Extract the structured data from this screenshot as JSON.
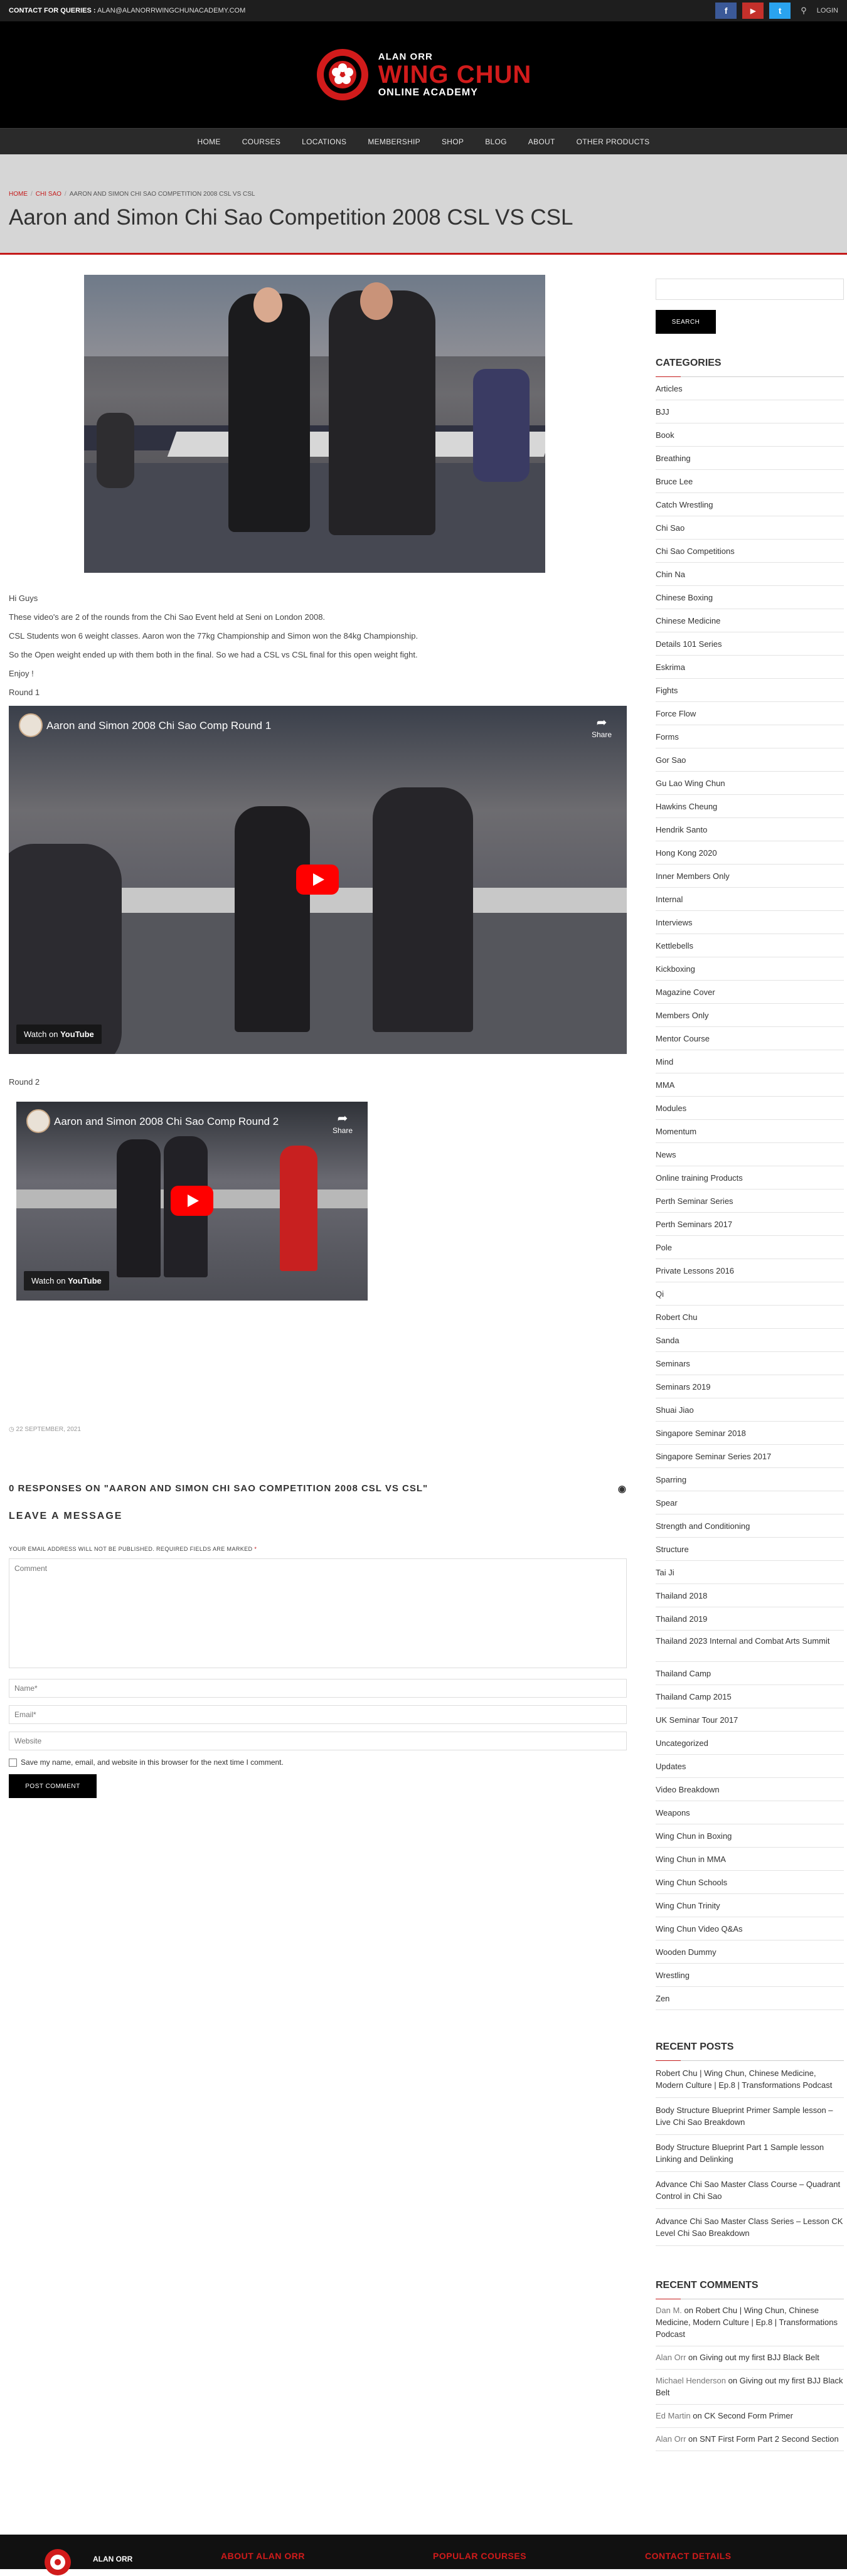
{
  "topbar": {
    "contact_label": "CONTACT FOR QUERIES :",
    "contact_email": "ALAN@ALANORRWINGCHUNACADEMY.COM",
    "social": [
      {
        "name": "facebook-icon",
        "glyph": "f",
        "color": "#3b5998"
      },
      {
        "name": "youtube-icon",
        "glyph": "▶",
        "color": "#c4302b"
      },
      {
        "name": "twitter-icon",
        "glyph": "t",
        "color": "#2aa3ef"
      }
    ],
    "search_glyph": "⚲",
    "login_label": "LOGIN"
  },
  "logo": {
    "line1": "ALAN ORR",
    "line2": "WING CHUN",
    "line3": "ONLINE ACADEMY"
  },
  "nav": [
    "HOME",
    "COURSES",
    "LOCATIONS",
    "MEMBERSHIP",
    "SHOP",
    "BLOG",
    "ABOUT",
    "OTHER PRODUCTS"
  ],
  "breadcrumb": {
    "home": "HOME",
    "category": "CHI SAO",
    "current": "AARON AND SIMON CHI SAO COMPETITION 2008 CSL VS CSL"
  },
  "page_title": "Aaron and Simon Chi Sao Competition 2008 CSL VS CSL",
  "article": {
    "paragraphs": [
      "Hi Guys",
      "These video's are 2 of the rounds from the Chi Sao Event held at Seni on London 2008.",
      "CSL Students won 6 weight classes.  Aaron won the 77kg Championship and Simon won the 84kg Championship.",
      "So the Open weight ended up with them both in the final. So we had a CSL vs CSL final for this open weight fight.",
      "Enjoy !",
      "Round 1"
    ],
    "round2": "Round 2",
    "video1": {
      "title": "Aaron and Simon 2008 Chi Sao Comp Round 1",
      "share": "Share",
      "watch": "Watch on",
      "brand": "YouTube"
    },
    "video2": {
      "title": "Aaron and Simon 2008 Chi Sao Comp Round 2",
      "share": "Share",
      "watch": "Watch on",
      "brand": "YouTube"
    },
    "date": "22 SEPTEMBER, 2021"
  },
  "comments": {
    "responses": "0 RESPONSES ON \"AARON AND SIMON CHI SAO COMPETITION 2008 CSL VS CSL\"",
    "leave": "LEAVE A MESSAGE",
    "note": "YOUR EMAIL ADDRESS WILL NOT BE PUBLISHED. REQUIRED FIELDS ARE MARKED",
    "note_req": "*",
    "comment_placeholder": "Comment",
    "name_placeholder": "Name*",
    "email_placeholder": "Email*",
    "website_placeholder": "Website",
    "save_label": "Save my name, email, and website in this browser for the next time I comment.",
    "post_label": "POST COMMENT"
  },
  "sidebar": {
    "search_label": "SEARCH",
    "categories_title": "CATEGORIES",
    "categories": [
      "Articles",
      "BJJ",
      "Book",
      "Breathing",
      "Bruce Lee",
      "Catch Wrestling",
      "Chi Sao",
      "Chi Sao Competitions",
      "Chin Na",
      "Chinese Boxing",
      "Chinese Medicine",
      "Details 101 Series",
      "Eskrima",
      "Fights",
      "Force Flow",
      "Forms",
      "Gor Sao",
      "Gu Lao Wing Chun",
      "Hawkins Cheung",
      "Hendrik Santo",
      "Hong Kong 2020",
      "Inner Members Only",
      "Internal",
      "Interviews",
      "Kettlebells",
      "Kickboxing",
      "Magazine Cover",
      "Members Only",
      "Mentor Course",
      "Mind",
      "MMA",
      "Modules",
      "Momentum",
      "News",
      "Online training Products",
      "Perth Seminar Series",
      "Perth Seminars 2017",
      "Pole",
      "Private Lessons 2016",
      "Qi",
      "Robert Chu",
      "Sanda",
      "Seminars",
      "Seminars 2019",
      "Shuai Jiao",
      "Singapore Seminar 2018",
      "Singapore Seminar Series 2017",
      "Sparring",
      "Spear",
      "Strength and Conditioning",
      "Structure",
      "Tai Ji",
      "Thailand 2018",
      "Thailand 2019",
      "Thailand 2023 Internal and Combat Arts Summit",
      "Thailand Camp",
      "Thailand Camp 2015",
      "UK Seminar Tour 2017",
      "Uncategorized",
      "Updates",
      "Video Breakdown",
      "Weapons",
      "Wing Chun in Boxing",
      "Wing Chun in MMA",
      "Wing Chun Schools",
      "Wing Chun Trinity",
      "Wing Chun Video Q&As",
      "Wooden Dummy",
      "Wrestling",
      "Zen"
    ],
    "recent_posts_title": "RECENT POSTS",
    "recent_posts": [
      "Robert Chu | Wing Chun, Chinese Medicine, Modern Culture | Ep.8 | Transformations Podcast",
      "Body Structure Blueprint Primer Sample lesson – Live Chi Sao Breakdown",
      "Body Structure Blueprint Part 1 Sample lesson Linking and Delinking",
      "Advance Chi Sao Master Class Course – Quadrant Control in Chi Sao",
      "Advance Chi Sao Master Class Series – Lesson CK Level Chi Sao Breakdown"
    ],
    "recent_comments_title": "RECENT COMMENTS",
    "recent_comments": [
      {
        "author": "Dan M.",
        "on": "on",
        "post": "Robert Chu | Wing Chun, Chinese Medicine, Modern Culture | Ep.8 | Transformations Podcast"
      },
      {
        "author": "Alan Orr",
        "on": "on",
        "post": "Giving out my first BJJ Black Belt"
      },
      {
        "author": "Michael Henderson",
        "on": "on",
        "post": "Giving out my first BJJ Black Belt"
      },
      {
        "author": "Ed Martin",
        "on": "on",
        "post": "CK Second Form Primer"
      },
      {
        "author": "Alan Orr",
        "on": "on",
        "post": "SNT First Form Part 2 Second Section"
      }
    ]
  },
  "footer": {
    "logo_text": "ALAN ORR",
    "about": "ABOUT ALAN ORR",
    "popular": "POPULAR COURSES",
    "contact": "CONTACT DETAILS"
  },
  "colors": {
    "accent": "#c41a1a",
    "dark": "#1e1e1e"
  }
}
